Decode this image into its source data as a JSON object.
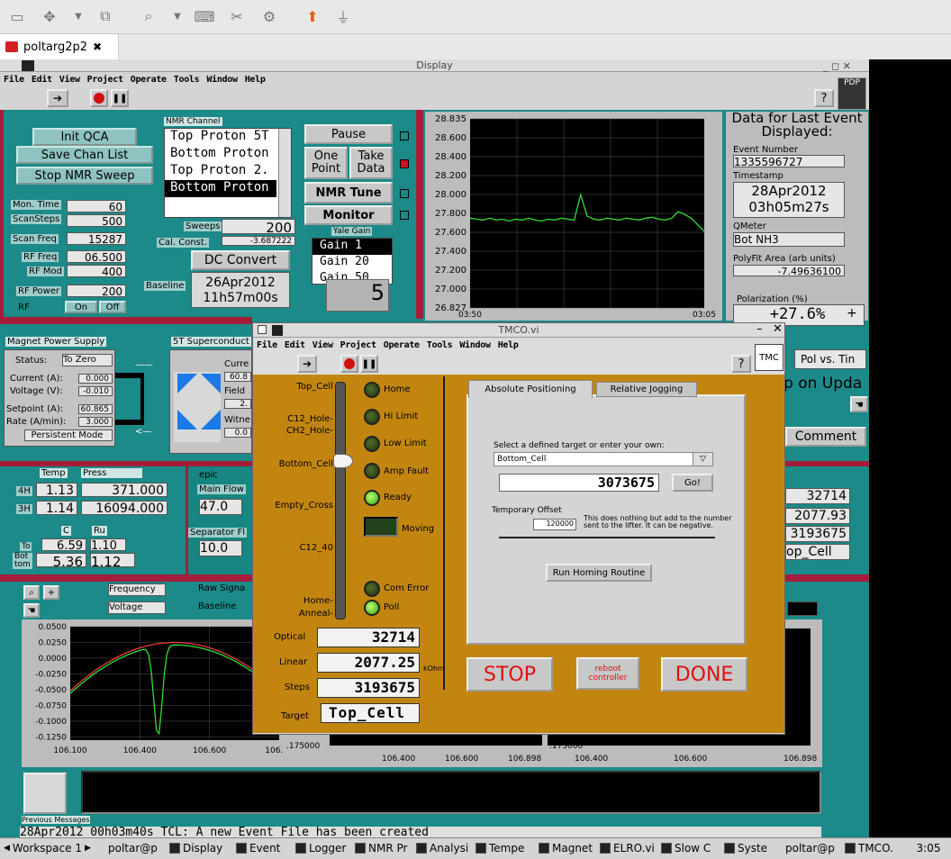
{
  "session_tab": {
    "title": "poltarg2p2",
    "close": "✖"
  },
  "display_window": {
    "title": "Display",
    "menu": [
      "File",
      "Edit",
      "View",
      "Project",
      "Operate",
      "Tools",
      "Window",
      "Help"
    ],
    "help_glyph": "?",
    "pdp_label": "PDP",
    "buttons": {
      "init_qca": "Init QCA",
      "save_chan_list": "Save Chan List",
      "stop_nmr_sweep": "Stop NMR Sweep"
    },
    "nmr_channel": {
      "label": "NMR Channel",
      "items": [
        "Top Proton 5T",
        "Bottom Proton",
        "Top Proton 2.",
        "Bottom Proton"
      ],
      "selected": 3
    },
    "params": [
      {
        "label": "Mon. Time",
        "value": "60"
      },
      {
        "label": "ScanSteps",
        "value": "500"
      },
      {
        "label": "Scan Freq",
        "value": "15287"
      },
      {
        "label": "RF Freq",
        "value": "06.500"
      },
      {
        "label": "RF Mod",
        "value": "400"
      },
      {
        "label": "RF Power",
        "value": "200"
      }
    ],
    "rf": {
      "label": "RF",
      "on": "On",
      "off": "Off"
    },
    "control_buttons": {
      "pause": "Pause",
      "one_point": "One\nPoint",
      "take_data": "Take\nData",
      "nmr_tune": "NMR Tune",
      "monitor": "Monitor"
    },
    "sweeps": {
      "label": "Sweeps",
      "value": "200"
    },
    "cal_const": {
      "label": "Cal. Const.",
      "value": "-3.687222"
    },
    "yale_gain": {
      "label": "Yale Gain",
      "items": [
        "Gain 1",
        "Gain 20",
        "Gain 50"
      ],
      "selected": 0,
      "digit": "5"
    },
    "dc_convert": "DC Convert",
    "baseline": {
      "label": "Baseline",
      "date": "26Apr2012",
      "time": "11h57m00s"
    },
    "last_event": {
      "title": "Data for Last Event Displayed:",
      "event_number_label": "Event Number",
      "event_number": "1335596727",
      "timestamp_label": "Timestamp",
      "timestamp_date": "28Apr2012",
      "timestamp_time": "03h05m27s",
      "qmeter_label": "QMeter",
      "qmeter": "Bot NH3",
      "polyfit_label": "PolyFit Area (arb units)",
      "polyfit": "-7.49636100",
      "polarization_label": "Polarization (%)",
      "polarization": "+27.6%"
    },
    "pol_vs_time": "Pol vs. Tin",
    "on_upda": "p on Upda",
    "comment_btn": "Comment",
    "right_readouts": [
      "32714",
      "2077.93",
      "3193675",
      "op_Cell"
    ],
    "magnet": {
      "title": "Magnet Power Supply",
      "status_label": "Status:",
      "status": "To Zero",
      "current_label": "Current (A):",
      "current": "0.000",
      "voltage_label": "Voltage (V):",
      "voltage": "-0.010",
      "setpoint_label": "Setpoint (A):",
      "setpoint": "60.865",
      "rate_label": "Rate (A/min):",
      "rate": "3.000",
      "mode": "Persistent Mode"
    },
    "superconduct": {
      "title": "5T Superconduct",
      "current_label": "Curre",
      "current": "60.8",
      "field_label": "Field",
      "field": "2.",
      "witness_label": "Witne",
      "witness": "0.0",
      "arrow_1": "——",
      "arrow_2": "<—"
    },
    "temp_press": {
      "temp_label": "Temp",
      "press_label": "Press",
      "rows": [
        {
          "label": "4H",
          "temp": "1.13",
          "press": "371.000"
        },
        {
          "label": "3H",
          "temp": "1.14",
          "press": "16094.000"
        }
      ],
      "c_label": "C",
      "ru_label": "Ru",
      "to_label": "To",
      "to_c": "6.59",
      "to_ru": "1.10",
      "bot_label": "Bot\ntom",
      "bot_c": "5.36",
      "bot_ru": "1.12"
    },
    "epic": {
      "label": "epic",
      "main_flow_label": "Main Flow",
      "main_flow": "47.0",
      "sep_flow_label": "Separator Fl",
      "sep_flow": "10.0"
    },
    "sweep_controls": {
      "frequency": "Frequency",
      "voltage": "Voltage",
      "raw_signal": "Raw Signa",
      "baseline": "Baseline"
    },
    "previous_messages_label": "Previous Messages",
    "message": "28Apr2012 00h03m40s TCL: A new Event File has been created"
  },
  "top_chart": {
    "chart_data": {
      "type": "line",
      "title": "",
      "xlabel": "",
      "ylabel": "",
      "ylim": [
        26.827,
        28.835
      ],
      "y_ticks": [
        "28.835",
        "28.600",
        "28.400",
        "28.200",
        "28.000",
        "27.800",
        "27.600",
        "27.400",
        "27.200",
        "27.000",
        "26.827"
      ],
      "x_ticks": [
        "03:50",
        "03:05"
      ],
      "series": [
        {
          "color": "#33dd33",
          "values": [
            27.78,
            27.77,
            27.76,
            27.78,
            27.76,
            27.77,
            27.75,
            27.77,
            27.76,
            27.78,
            27.76,
            27.75,
            27.77,
            27.76,
            27.78,
            27.77,
            27.76,
            28.03,
            27.8,
            27.77,
            27.76,
            27.78,
            27.77,
            27.76,
            27.78,
            27.77,
            27.76,
            27.78,
            27.79,
            27.77,
            27.76,
            27.78,
            27.85,
            27.82,
            27.78,
            27.71,
            27.64
          ]
        }
      ]
    }
  },
  "bottom_chart": {
    "chart_data": {
      "type": "line",
      "title": "",
      "xlabel": "",
      "ylabel": "",
      "ylim": [
        -0.13,
        0.05
      ],
      "y_ticks": [
        "0.0500",
        "0.0250",
        "0.0000",
        "-0.0250",
        "-0.0500",
        "-0.0750",
        "-0.1000",
        "-0.1250"
      ],
      "x_ticks": [
        "106.100",
        "106.400",
        "106.600",
        "106.89"
      ],
      "series": [
        {
          "color": "#ff4040",
          "shape": "parabola",
          "peak": 0.025
        },
        {
          "color": "#33dd33",
          "shape": "dip",
          "min": -0.123
        }
      ]
    }
  },
  "mid_chart_ticks": {
    "y": [
      ".175000"
    ],
    "x": [
      "106.400",
      "106.600",
      "106.898",
      "106.400",
      "106.600",
      "106.898"
    ]
  },
  "tmco": {
    "title": "TMCO.vi",
    "menu": [
      "File",
      "Edit",
      "View",
      "Project",
      "Operate",
      "Tools",
      "Window",
      "Help"
    ],
    "help_glyph": "?",
    "logo": "TMC",
    "positions": [
      "Top_Cell",
      "C12_Hole-",
      "CH2_Hole-",
      "Bottom_Cell",
      "Empty_Cross",
      "C12_40",
      "Home-",
      "Anneal-"
    ],
    "leds": [
      {
        "label": "Home",
        "on": false
      },
      {
        "label": "Hi Limit",
        "on": false
      },
      {
        "label": "Low Limit",
        "on": false
      },
      {
        "label": "Amp Fault",
        "on": false
      },
      {
        "label": "Ready",
        "on": true
      },
      {
        "label": "Moving",
        "on": false
      },
      {
        "label": "Com Error",
        "on": false
      },
      {
        "label": "Poll",
        "on": true
      }
    ],
    "readouts": {
      "optical_label": "Optical",
      "optical": "32714",
      "linear_label": "Linear",
      "linear": "2077.25",
      "linear_unit": "kOhm",
      "steps_label": "Steps",
      "steps": "3193675",
      "target_label": "Target",
      "target": "Top_Cell"
    },
    "tabs": [
      "Absolute Positioning",
      "Relative Jogging"
    ],
    "select_prompt": "Select a defined target or enter your own:",
    "select_value": "Bottom_Cell",
    "target_value": "3073675",
    "go_btn": "Go!",
    "temp_offset_label": "Temporary Offset",
    "temp_offset": "120000",
    "offset_note": "This does nothing but add to the number sent to the lifter. It can be negative.",
    "homing_btn": "Run Homing Routine",
    "stop_btn": "STOP",
    "reboot_btn": "reboot controller",
    "done_btn": "DONE"
  },
  "taskbar": {
    "workspace": "Workspace 1",
    "items": [
      "poltar@p",
      "Display",
      "Event",
      "Logger",
      "NMR Pr",
      "Analysi",
      "Tempe",
      "Magnet",
      "ELRO.vi",
      "Slow C",
      "Syste",
      "poltar@p",
      "TMCO."
    ],
    "clock": "3:05"
  }
}
